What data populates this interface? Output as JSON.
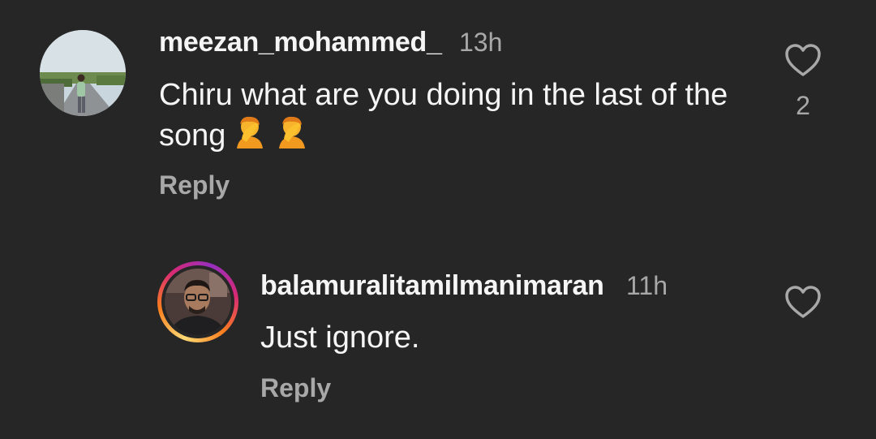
{
  "comment": {
    "username": "meezan_mohammed_",
    "time": "13h",
    "text": "Chiru what are you doing in the last of the song",
    "emojis": [
      "face-palm-emoji",
      "face-palm-emoji"
    ],
    "reply_label": "Reply",
    "like_count": "2",
    "like_icon": "heart-outline-icon"
  },
  "reply_comment": {
    "username": "balamuralitamilmanimaran",
    "time": "11h",
    "text": "Just ignore.",
    "reply_label": "Reply",
    "like_icon": "heart-outline-icon",
    "story_ring_colors": [
      "#feda75",
      "#fa7e1e",
      "#d62976",
      "#962fbf"
    ]
  },
  "colors": {
    "background": "#262626",
    "primary_text": "#f5f5f5",
    "secondary_text": "#a8a8a8"
  }
}
